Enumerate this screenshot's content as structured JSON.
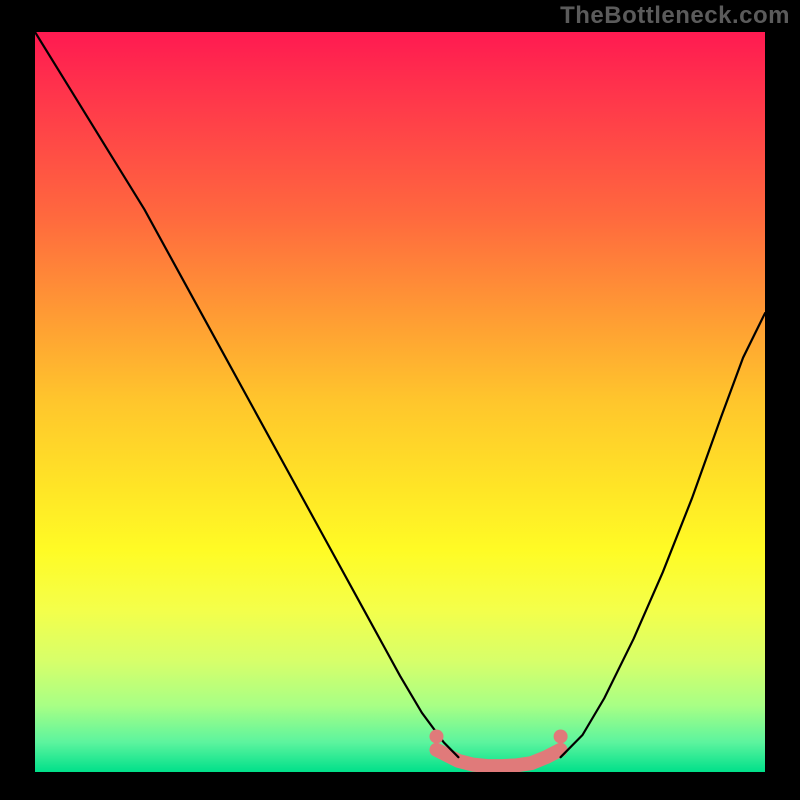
{
  "watermark": "TheBottleneck.com",
  "chart_data": {
    "type": "line",
    "title": "",
    "xlabel": "",
    "ylabel": "",
    "xlim": [
      0,
      100
    ],
    "ylim": [
      0,
      100
    ],
    "series": [
      {
        "name": "left-curve",
        "x": [
          0,
          5,
          10,
          15,
          20,
          25,
          30,
          35,
          40,
          45,
          50,
          53,
          56,
          58
        ],
        "y": [
          100,
          92,
          84,
          76,
          67,
          58,
          49,
          40,
          31,
          22,
          13,
          8,
          4,
          2
        ]
      },
      {
        "name": "right-curve",
        "x": [
          72,
          75,
          78,
          82,
          86,
          90,
          94,
          97,
          100
        ],
        "y": [
          2,
          5,
          10,
          18,
          27,
          37,
          48,
          56,
          62
        ]
      },
      {
        "name": "bottom-band",
        "x": [
          55,
          58,
          60,
          62,
          64,
          66,
          68,
          70,
          72
        ],
        "y": [
          3,
          1.5,
          1,
          0.8,
          0.8,
          0.9,
          1.2,
          2,
          3
        ]
      }
    ],
    "annotations": [],
    "colors": {
      "curve": "#000000",
      "band": "#E07A7A",
      "gradient_top": "#ff1a51",
      "gradient_bottom": "#00e08a"
    }
  }
}
